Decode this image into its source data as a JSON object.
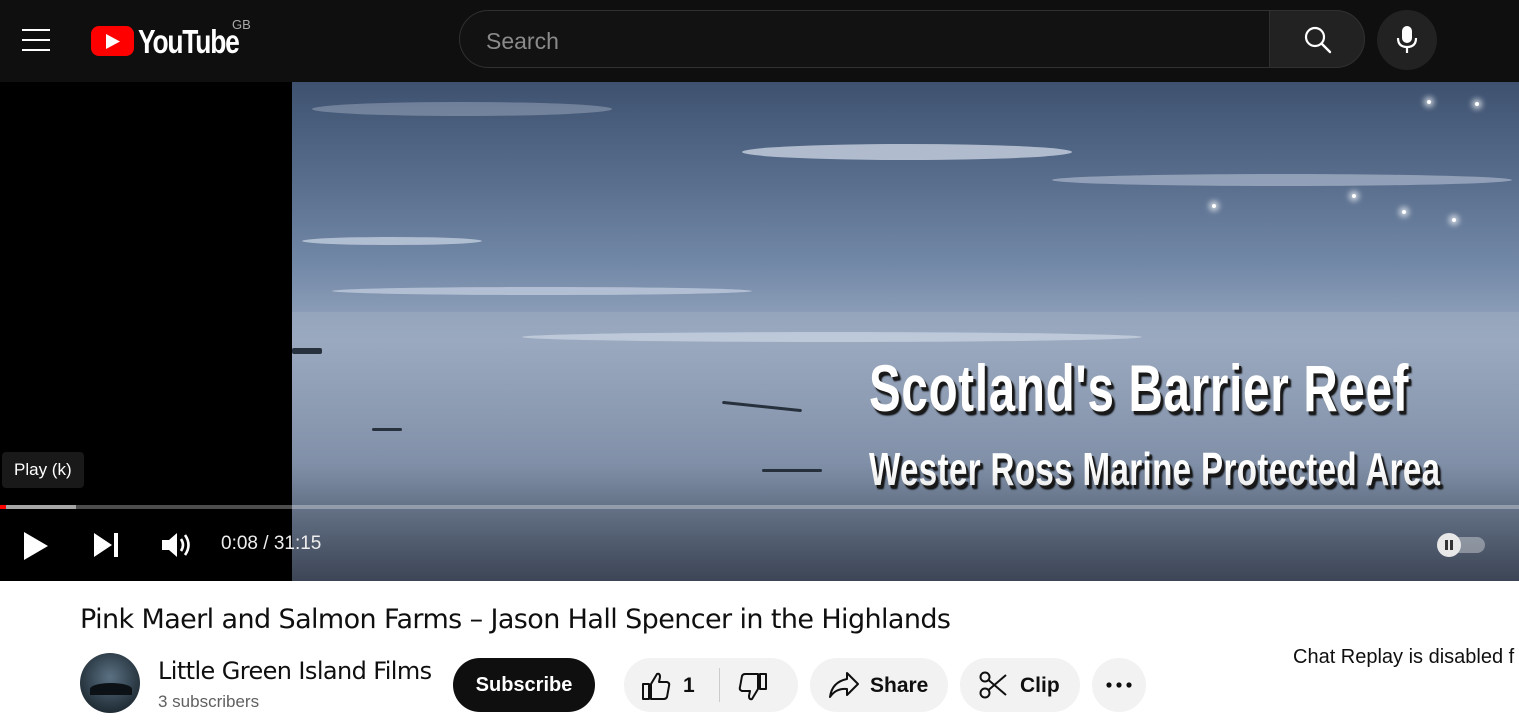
{
  "header": {
    "logo_text": "YouTube",
    "region_code": "GB",
    "search_placeholder": "Search",
    "icons": [
      "menu-icon",
      "search-icon",
      "mic-icon"
    ]
  },
  "player": {
    "overlay_title": "Scotland's Barrier Reef",
    "overlay_subtitle": "Wester Ross Marine Protected Area",
    "tooltip": "Play (k)",
    "time_display": "0:08 / 31:15",
    "progress_played_fraction": 0.004,
    "progress_buffered_fraction": 0.05,
    "autoplay_state": "on",
    "icons": [
      "play-icon",
      "next-icon",
      "volume-icon",
      "autoplay-toggle"
    ]
  },
  "video": {
    "title": "Pink Maerl and Salmon Farms – Jason Hall Spencer in the Highlands",
    "channel_name": "Little Green Island Films",
    "subscriber_count": "3 subscribers",
    "subscribe_label": "Subscribe",
    "like_count": "1",
    "share_label": "Share",
    "clip_label": "Clip"
  },
  "chat": {
    "replay_message": "Chat Replay is disabled f"
  },
  "colors": {
    "header_bg": "#0f0f0f",
    "brand_red": "#ff0000",
    "progress_played": "#ff0000",
    "subscribe_bg": "#0f0f0f",
    "pill_bg": "#f2f2f2"
  }
}
